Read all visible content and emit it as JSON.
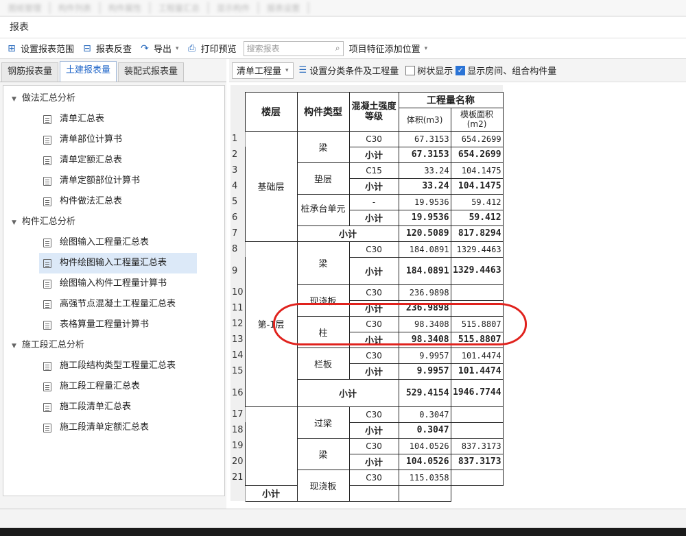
{
  "top_strip": [
    "图纸管理",
    "构件列表",
    "构件属性",
    "工程量汇总",
    "显示构件",
    "报表设置"
  ],
  "panel": {
    "title": "报表"
  },
  "toolbar": {
    "set_range": "设置报表范围",
    "reverse": "报表反查",
    "export": "导出",
    "print_preview": "打印预览",
    "search_placeholder": "搜索报表",
    "feature_position": "项目特征添加位置"
  },
  "tabs": [
    "钢筋报表量",
    "土建报表量",
    "装配式报表量"
  ],
  "tree": [
    {
      "group": "做法汇总分析",
      "items": [
        "清单汇总表",
        "清单部位计算书",
        "清单定额汇总表",
        "清单定额部位计算书",
        "构件做法汇总表"
      ]
    },
    {
      "group": "构件汇总分析",
      "items": [
        "绘图输入工程量汇总表",
        "构件绘图输入工程量汇总表",
        "绘图输入构件工程量计算书",
        "高强节点混凝土工程量汇总表",
        "表格算量工程量计算书"
      ]
    },
    {
      "group": "施工段汇总分析",
      "items": [
        "施工段结构类型工程量汇总表",
        "施工段工程量汇总表",
        "施工段清单汇总表",
        "施工段清单定额汇总表"
      ]
    }
  ],
  "subbar": {
    "dropdown": "清单工程量",
    "set_conditions": "设置分类条件及工程量",
    "tree_display": "树状显示",
    "show_rooms": "显示房间、组合构件量"
  },
  "table": {
    "headers": {
      "floor": "楼层",
      "type": "构件类型",
      "grade": "混凝土强度等级",
      "qty_name": "工程量名称",
      "volume": "体积(m3)",
      "formwork": "模板面积(m2)"
    },
    "row_numbers": [
      "1",
      "2",
      "3",
      "4",
      "5",
      "6",
      "7",
      "8",
      "9",
      "10",
      "11",
      "12",
      "13",
      "14",
      "15",
      "16",
      "17",
      "18",
      "19",
      "20",
      "21"
    ],
    "floors": [
      "基础层",
      "第-1层"
    ],
    "types": [
      "梁",
      "垫层",
      "桩承台单元",
      "梁",
      "现浇板",
      "柱",
      "栏板",
      "过梁",
      "梁",
      "现浇板"
    ],
    "subtotal": "小计",
    "rows": [
      {
        "grade": "C30",
        "volume": "67.3153",
        "formwork": "654.2699"
      },
      {
        "grade": "小计",
        "volume": "67.3153",
        "formwork": "654.2699"
      },
      {
        "grade": "C15",
        "volume": "33.24",
        "formwork": "104.1475"
      },
      {
        "grade": "小计",
        "volume": "33.24",
        "formwork": "104.1475"
      },
      {
        "grade": "-",
        "volume": "19.9536",
        "formwork": "59.412"
      },
      {
        "grade": "小计",
        "volume": "19.9536",
        "formwork": "59.412"
      },
      {
        "grade": "",
        "volume": "120.5089",
        "formwork": "817.8294"
      },
      {
        "grade": "C30",
        "volume": "184.0891",
        "formwork": "1329.4463"
      },
      {
        "grade": "小计",
        "volume": "184.0891",
        "formwork": "1329.4463"
      },
      {
        "grade": "C30",
        "volume": "236.9898",
        "formwork": ""
      },
      {
        "grade": "小计",
        "volume": "236.9898",
        "formwork": ""
      },
      {
        "grade": "C30",
        "volume": "98.3408",
        "formwork": "515.8807"
      },
      {
        "grade": "小计",
        "volume": "98.3408",
        "formwork": "515.8807"
      },
      {
        "grade": "C30",
        "volume": "9.9957",
        "formwork": "101.4474"
      },
      {
        "grade": "小计",
        "volume": "9.9957",
        "formwork": "101.4474"
      },
      {
        "grade": "",
        "volume": "529.4154",
        "formwork": "1946.7744"
      },
      {
        "grade": "C30",
        "volume": "0.3047",
        "formwork": ""
      },
      {
        "grade": "小计",
        "volume": "0.3047",
        "formwork": ""
      },
      {
        "grade": "C30",
        "volume": "104.0526",
        "formwork": "837.3173"
      },
      {
        "grade": "小计",
        "volume": "104.0526",
        "formwork": "837.3173"
      },
      {
        "grade": "C30",
        "volume": "115.0358",
        "formwork": ""
      }
    ]
  },
  "colors": {
    "accent": "#1e64c8",
    "annotation": "#e0221d",
    "selected_row": "#dce9f8"
  }
}
